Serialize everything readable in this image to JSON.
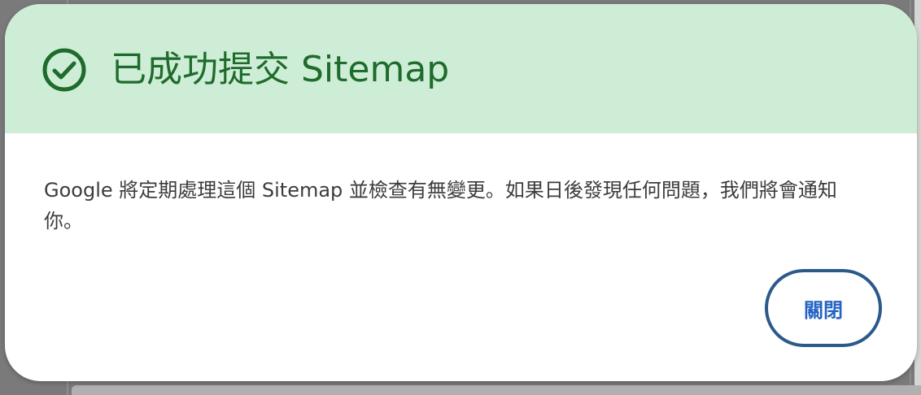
{
  "dialog": {
    "title": "已成功提交 Sitemap",
    "message": "Google 將定期處理這個 Sitemap 並檢查有無變更。如果日後發現任何問題，我們將會通知你。",
    "close_label": "關閉",
    "icon": "check-circle-icon"
  },
  "colors": {
    "header_bg": "#ceedd6",
    "title_green": "#1e6b2c",
    "button_text": "#2563c4",
    "button_border": "#2b5a8a"
  }
}
